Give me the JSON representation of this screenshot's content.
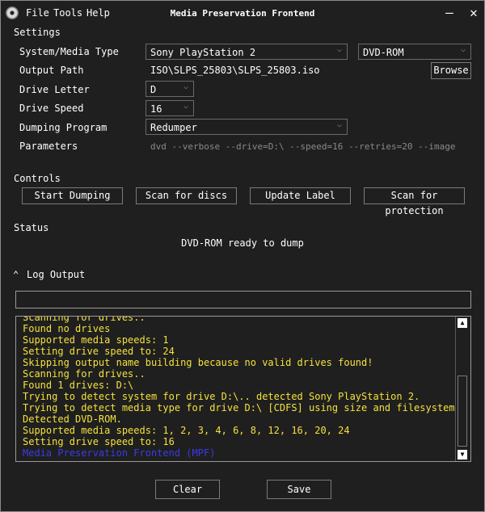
{
  "window": {
    "title": "Media Preservation Frontend",
    "menu": [
      "File",
      "Tools",
      "Help"
    ],
    "minimize": "—",
    "close": "✕"
  },
  "settings": {
    "heading": "Settings",
    "system_label": "System/Media Type",
    "system_value": "Sony PlayStation 2",
    "media_value": "DVD-ROM",
    "output_label": "Output Path",
    "output_value": "ISO\\SLPS_25803\\SLPS_25803.iso",
    "browse_label": "Browse",
    "drive_letter_label": "Drive Letter",
    "drive_letter_value": "D",
    "drive_speed_label": "Drive Speed",
    "drive_speed_value": "16",
    "dumping_label": "Dumping Program",
    "dumping_value": "Redumper",
    "parameters_label": "Parameters",
    "parameters_value": "dvd --verbose --drive=D:\\ --speed=16 --retries=20 --image"
  },
  "controls": {
    "heading": "Controls",
    "start": "Start Dumping",
    "scan": "Scan for discs",
    "update": "Update Label",
    "protect": "Scan for protection"
  },
  "status": {
    "heading": "Status",
    "text": "DVD-ROM ready to dump"
  },
  "log": {
    "heading": "Log Output",
    "input_value": "",
    "lines": [
      "Scanning for drives..",
      "Found no drives",
      "Supported media speeds: 1",
      "Setting drive speed to: 24",
      "Skipping output name building because no valid drives found!",
      "Scanning for drives..",
      "Found 1 drives: D:\\",
      "Trying to detect system for drive D:\\.. detected Sony PlayStation 2.",
      "Trying to detect media type for drive D:\\ [CDFS] using size and filesystem..",
      "Detected DVD-ROM.",
      "Supported media speeds: 1, 2, 3, 4, 6, 8, 12, 16, 20, 24",
      "Setting drive speed to: 16",
      "Media Preservation Frontend (MPF)"
    ]
  },
  "footer": {
    "clear": "Clear",
    "save": "Save"
  },
  "colors": {
    "background": "#1f1f1f",
    "log_text": "#f4e23c",
    "log_footer": "#3b3be8"
  }
}
